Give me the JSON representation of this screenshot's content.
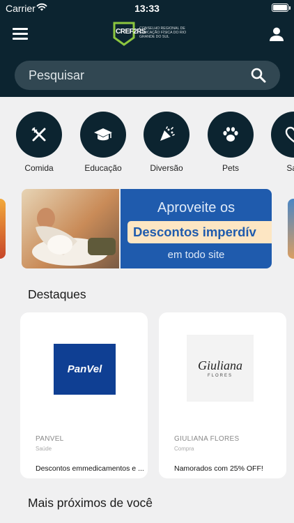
{
  "status_bar": {
    "carrier": "Carrier",
    "time": "13:33"
  },
  "header": {
    "logo_mark": "CREF2RS",
    "logo_text": "CONSELHO REGIONAL DE EDUCAÇÃO FÍSICA DO RIO GRANDE DO SUL",
    "search": {
      "placeholder": "Pesquisar"
    }
  },
  "categories": [
    {
      "label": "Comida",
      "icon": "utensils-icon"
    },
    {
      "label": "Educação",
      "icon": "graduation-cap-icon"
    },
    {
      "label": "Diversão",
      "icon": "party-popper-icon"
    },
    {
      "label": "Pets",
      "icon": "paw-icon"
    },
    {
      "label": "Saú",
      "icon": "heart-icon"
    }
  ],
  "banner": {
    "line1": "Aproveite os",
    "line2": "Descontos imperdív",
    "line3": "em todo site"
  },
  "highlights": {
    "title": "Destaques",
    "cards": [
      {
        "logo_text": "PanVel",
        "name": "PANVEL",
        "category": "Saúde",
        "description": "Descontos emmedicamentos e ..."
      },
      {
        "logo_text": "Giuliana",
        "logo_sub": "FLORES",
        "name": "GIULIANA FLORES",
        "category": "Compra",
        "description": "Namorados com 25% OFF!"
      }
    ]
  },
  "nearby": {
    "title": "Mais próximos de você"
  },
  "colors": {
    "header_bg": "#0c2430",
    "search_bg": "#314752",
    "brand_green": "#8cc63f",
    "panvel_blue": "#0f3f93",
    "banner_blue": "#1f5bad"
  }
}
